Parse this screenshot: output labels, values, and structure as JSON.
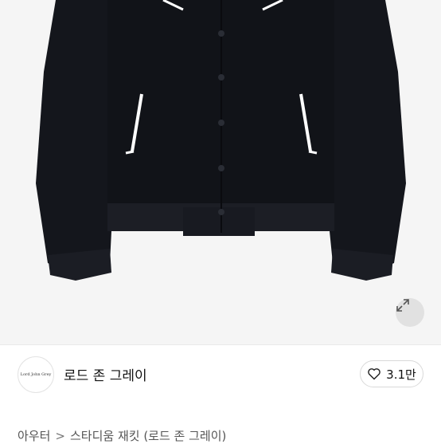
{
  "product_image": {
    "alt": "black stadium jacket",
    "expand_icon": "expand-icon"
  },
  "shop": {
    "avatar_text": "Lord John Grey",
    "name": "로드 존 그레이"
  },
  "like": {
    "icon": "heart-icon",
    "count": "3.1만"
  },
  "breadcrumb": {
    "category": "아우터",
    "separator": ">",
    "subcategory": "스타디움 재킷 (로드 존 그레이)"
  },
  "colors": {
    "jacket": "#14161c",
    "background": "#f5f5f5",
    "piping": "#ffffff"
  }
}
